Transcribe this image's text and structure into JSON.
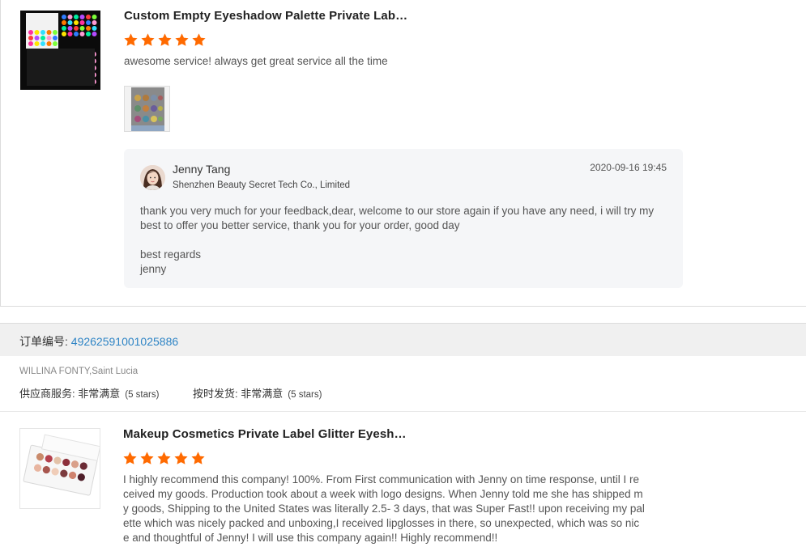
{
  "reviews": [
    {
      "product_title": "Custom Empty Eyeshadow Palette Private Lab…",
      "rating": 5,
      "comment": "awesome service! always get great service all the time",
      "reply": {
        "name": "Jenny Tang",
        "company": "Shenzhen Beauty Secret Tech Co., Limited",
        "date": "2020-09-16 19:45",
        "text": "thank you very much for your feedback,dear, welcome to our store again if you have any need, i will try my best to offer you better service, thank you for your order, good day",
        "sign_line1": "best regards",
        "sign_line2": "jenny"
      }
    },
    {
      "product_title": "Makeup Cosmetics Private Label Glitter Eyesh…",
      "rating": 5,
      "comment_lines": [
        "I highly recommend this company! 100%. From First communication with Jenny on time response, until I re",
        "ceived my goods. Production took about a week with logo designs. When Jenny told me she has shipped m",
        "y goods,  Shipping to the United States was literally 2.5- 3 days, that was Super Fast!! upon receiving my pal",
        "ette which was nicely packed and unboxing,I received lipglosses in there, so unexpected,  which was so nic",
        "e and thoughtful of Jenny! I will use this company again!! Highly recommend!!"
      ]
    }
  ],
  "order": {
    "label": "订单编号: ",
    "number": "49262591001025886",
    "buyer": "WILLINA FONTY,Saint Lucia",
    "supplier_service_label": "供应商服务: ",
    "supplier_service_value": "非常满意",
    "supplier_service_stars": "(5 stars)",
    "on_time_label": "按时发货: ",
    "on_time_value": "非常满意",
    "on_time_stars": "(5 stars)"
  },
  "colors": {
    "star": "#ff6a00",
    "link": "#2e84c5",
    "reply_bg": "#f5f6f8",
    "order_bar_bg": "#f0f0f0"
  },
  "icons": {
    "star": "star-icon"
  }
}
